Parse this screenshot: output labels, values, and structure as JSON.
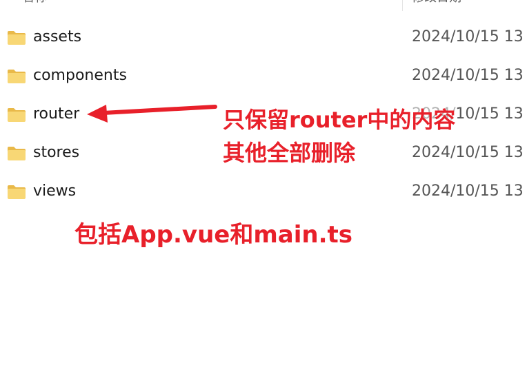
{
  "header": {
    "name_label": "名称",
    "date_label": "修改日期"
  },
  "files": [
    {
      "name": "assets",
      "date": "2024/10/15 13",
      "icon": "folder-icon"
    },
    {
      "name": "components",
      "date": "2024/10/15 13",
      "icon": "folder-icon"
    },
    {
      "name": "router",
      "date": "2024/10/15 13",
      "icon": "folder-icon"
    },
    {
      "name": "stores",
      "date": "2024/10/15 13",
      "icon": "folder-icon"
    },
    {
      "name": "views",
      "date": "2024/10/15 13",
      "icon": "folder-icon"
    }
  ],
  "annotations": {
    "line1": "只保留router中的内容",
    "line2": "其他全部删除",
    "line3": "包括App.vue和main.ts",
    "color": "#e8202a"
  },
  "colors": {
    "folder_body": "#f8d775",
    "folder_tab": "#e9b949",
    "text": "#1a1a1a",
    "date_text": "#555555"
  }
}
